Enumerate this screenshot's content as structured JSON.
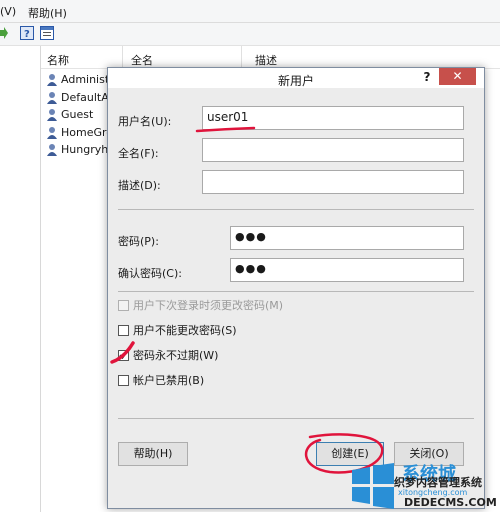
{
  "menubar": {
    "view": "(V)",
    "help": "帮助(H)"
  },
  "list": {
    "columns": [
      "名称",
      "全名",
      "描述"
    ],
    "users": [
      "Administ",
      "DefaultAc",
      "Guest",
      "HomeGro",
      "Hungryhe"
    ]
  },
  "dialog": {
    "title": "新用户",
    "help_glyph": "?",
    "close_glyph": "✕",
    "username_label": "用户名(U):",
    "username_value": "user01",
    "fullname_label": "全名(F):",
    "fullname_value": "",
    "description_label": "描述(D):",
    "description_value": "",
    "password_label": "密码(P):",
    "password_value": "●●●",
    "confirm_label": "确认密码(C):",
    "confirm_value": "●●●",
    "opt_must_change": "用户下次登录时须更改密码(M)",
    "opt_cannot_change": "用户不能更改密码(S)",
    "opt_never_expires": "密码永不过期(W)",
    "opt_disabled": "帐户已禁用(B)",
    "help_button": "帮助(H)",
    "create_button": "创建(E)",
    "close_button": "关闭(O)"
  },
  "watermark": {
    "brand": "系统城",
    "cn": "织梦内容管理系统",
    "url1": "xitongcheng.com",
    "url2": "DEDECMS.COM"
  },
  "colors": {
    "close": "#c7504b",
    "annotation": "#e0143c",
    "accent": "#3c7fb1"
  }
}
